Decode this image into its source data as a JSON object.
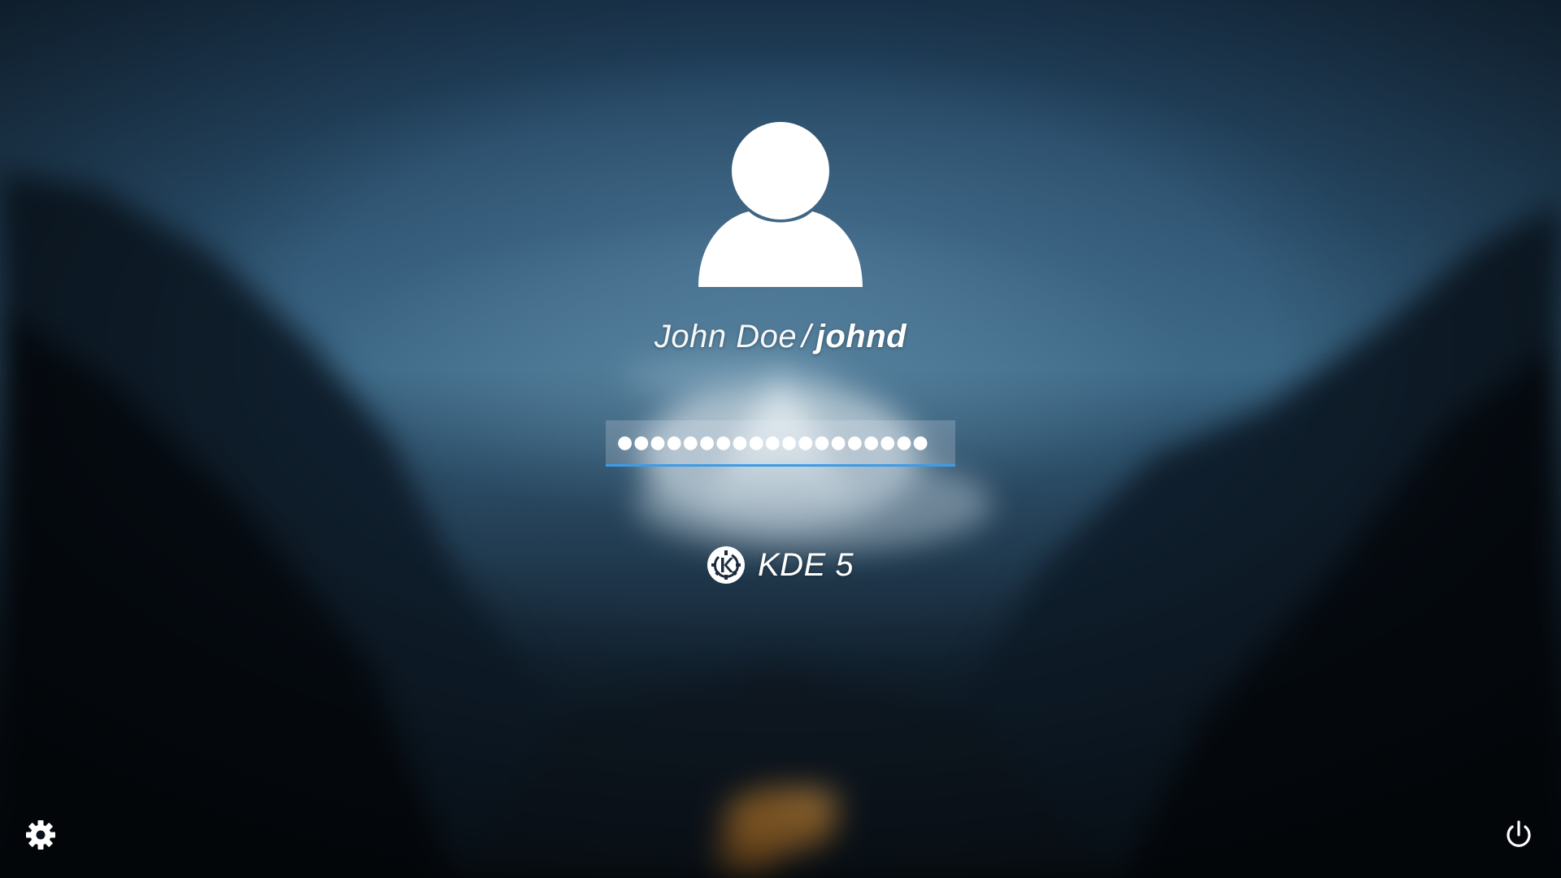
{
  "user": {
    "full_name": "John Doe",
    "separator": "/",
    "username": "johnd",
    "avatar_icon": "user-avatar-icon"
  },
  "password": {
    "masked_value": "●●●●●●●●●●●●●●●●●●●",
    "accent_color": "#3d9be9"
  },
  "session": {
    "label": "KDE 5",
    "icon": "kde-logo-icon"
  },
  "controls": {
    "settings_icon": "gear-icon",
    "power_icon": "power-icon"
  }
}
